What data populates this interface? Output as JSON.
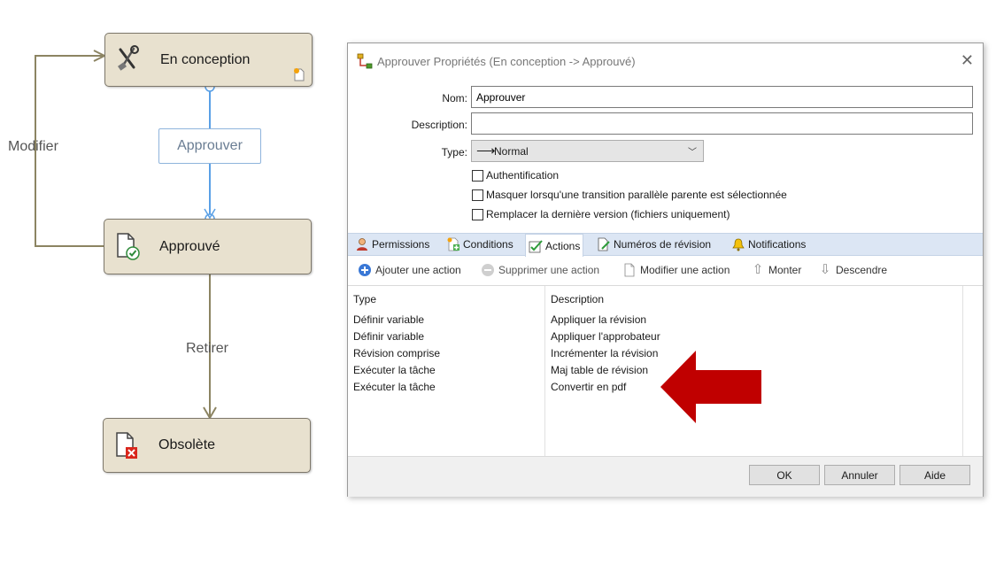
{
  "workflow": {
    "states": {
      "design": "En conception",
      "approved": "Approuvé",
      "obsolete": "Obsolète"
    },
    "transitions": {
      "modify": "Modifier",
      "approve": "Approuver",
      "withdraw": "Retirer"
    }
  },
  "dialog": {
    "title": "Approuver Propriétés (En conception -> Approuvé)",
    "fields": {
      "name_label": "Nom:",
      "name_value": "Approuver",
      "description_label": "Description:",
      "description_value": "",
      "type_label": "Type:",
      "type_value": "Normal"
    },
    "checkboxes": {
      "auth": "Authentification",
      "hide": "Masquer lorsqu'une transition parallèle parente est sélectionnée",
      "replace": "Remplacer la dernière version (fichiers uniquement)"
    },
    "tabs": {
      "permissions": "Permissions",
      "conditions": "Conditions",
      "actions": "Actions",
      "revisions": "Numéros de révision",
      "notifications": "Notifications"
    },
    "toolbar": {
      "add": "Ajouter une action",
      "delete": "Supprimer une action",
      "edit": "Modifier une action",
      "up": "Monter",
      "down": "Descendre"
    },
    "table": {
      "headers": {
        "type": "Type",
        "description": "Description"
      },
      "rows": [
        {
          "type": "Définir variable",
          "description": "Appliquer la révision"
        },
        {
          "type": "Définir variable",
          "description": "Appliquer l'approbateur"
        },
        {
          "type": "Révision comprise",
          "description": "Incrémenter la révision"
        },
        {
          "type": "Exécuter la tâche",
          "description": "Maj table de révision"
        },
        {
          "type": "Exécuter la tâche",
          "description": "Convertir en pdf"
        }
      ]
    },
    "buttons": {
      "ok": "OK",
      "cancel": "Annuler",
      "help": "Aide"
    }
  },
  "colors": {
    "state_fill": "#e8e1cf",
    "connector": "#8c8462",
    "transition_line": "#5aa0e6",
    "highlight_arrow": "#c00000"
  }
}
